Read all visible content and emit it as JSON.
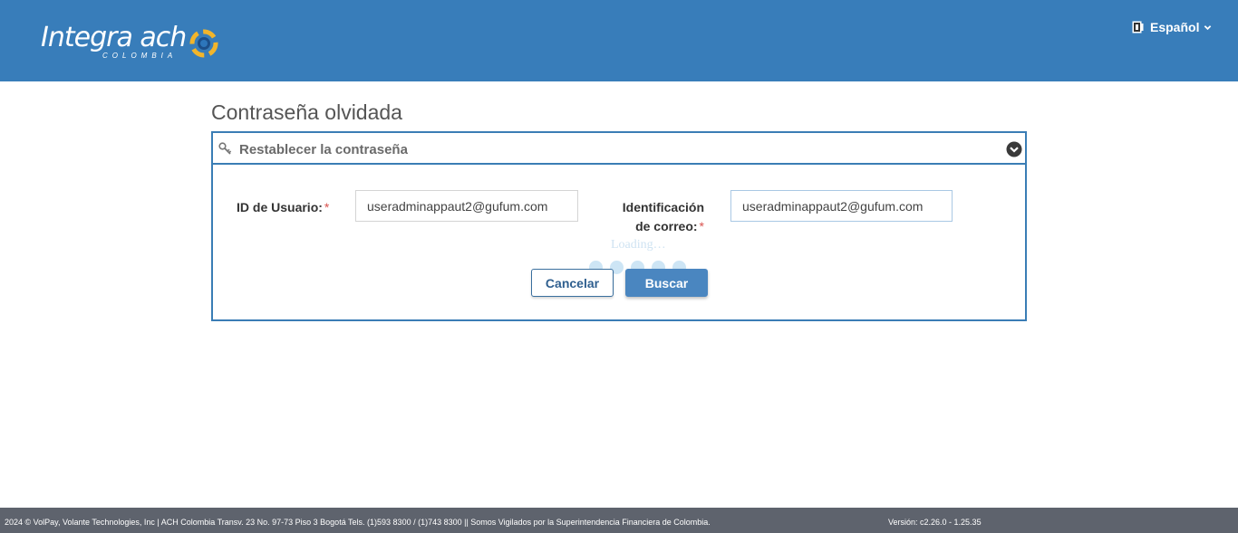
{
  "header": {
    "logo_text": "Integra ach",
    "logo_sub": "COLOMBIA",
    "language_label": "Español",
    "bg_color": "#387dba"
  },
  "page": {
    "title": "Contraseña olvidada"
  },
  "panel": {
    "title": "Restablecer la contraseña",
    "user_id_label": "ID de Usuario:",
    "email_label_line1": "Identificación",
    "email_label_line2": "de correo:",
    "required_mark": "*",
    "user_id_value": "useradminappaut2@gufum.com",
    "email_value": "useradminappaut2@gufum.com",
    "loading_text": "Loading…",
    "cancel_label": "Cancelar",
    "search_label": "Buscar"
  },
  "footer": {
    "copyright": "2024 © VolPay, Volante Technologies, Inc | ACH Colombia Transv. 23 No. 97-73 Piso 3 Bogotá Tels. (1)593 8300 / (1)743 8300 || Somos Vigilados por la Superintendencia Financiera de Colombia.",
    "version": "Versión: c2.26.0 - 1.25.35"
  },
  "icons": {
    "language": "flag-icon",
    "language_toggle": "chevron-down-icon",
    "panel": "key-icon",
    "collapse": "chevron-circle-down-icon",
    "loading": "loading-dots-icon"
  },
  "colors": {
    "primary": "#387dba",
    "button": "#4a86c0",
    "required": "#d9534f",
    "footer": "#5e636d"
  }
}
